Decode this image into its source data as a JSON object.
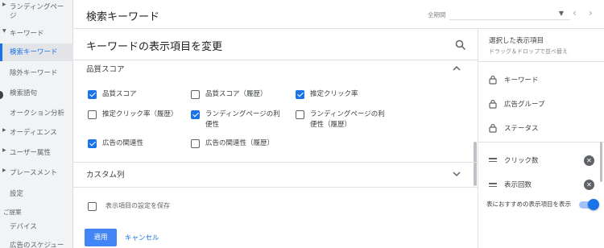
{
  "sidebar": {
    "items": [
      {
        "label": "ランディングペー"
      },
      {
        "label": "ジ"
      },
      {
        "label": "キーワード"
      },
      {
        "label": "検索キーワード"
      },
      {
        "label": "除外キーワード"
      },
      {
        "label": "検索語句"
      },
      {
        "label": "オークション分析"
      },
      {
        "label": "オーディエンス"
      },
      {
        "label": "ユーザー属性"
      },
      {
        "label": "プレースメント"
      },
      {
        "label": "設定"
      },
      {
        "label": "ご提案"
      },
      {
        "label": "デバイス"
      },
      {
        "label": "広告のスケジュー"
      }
    ]
  },
  "header": {
    "title": "検索キーワード",
    "period_label": "全期間",
    "prev_icon": "chevron-left-icon",
    "next_icon": "chevron-right-icon"
  },
  "dialog": {
    "title": "キーワードの表示項目を変更",
    "sections": {
      "quality": {
        "label": "品質スコア"
      },
      "custom": {
        "label": "カスタム列"
      }
    },
    "options": [
      {
        "label": "品質スコア",
        "checked": true
      },
      {
        "label": "品質スコア（履歴）",
        "checked": false
      },
      {
        "label": "推定クリック率",
        "checked": true
      },
      {
        "label": "推定クリック率（履歴）",
        "checked": false
      },
      {
        "label_line1": "ランディングページの利",
        "label_line2": "便性",
        "checked": true
      },
      {
        "label_line1": "ランディングページの利",
        "label_line2": "便性（履歴）",
        "checked": false
      },
      {
        "label": "広告の関連性",
        "checked": true
      },
      {
        "label": "広告の関連性（履歴）",
        "checked": false
      }
    ],
    "save_settings_label": "表示項目の設定を保存",
    "apply_label": "適用",
    "cancel_label": "キャンセル"
  },
  "selected_panel": {
    "title": "選択した表示項目",
    "subtitle": "ドラッグ＆ドロップで並べ替え",
    "locked": [
      {
        "label": "キーワード"
      },
      {
        "label": "広告グループ"
      },
      {
        "label": "ステータス"
      }
    ],
    "movable": [
      {
        "label": "クリック数"
      },
      {
        "label": "表示回数"
      }
    ],
    "recommend_label": "表におすすめの表示項目を表示",
    "recommend_on": true
  },
  "colors": {
    "accent": "#1a73e8",
    "apply_button": "#4285f4"
  }
}
